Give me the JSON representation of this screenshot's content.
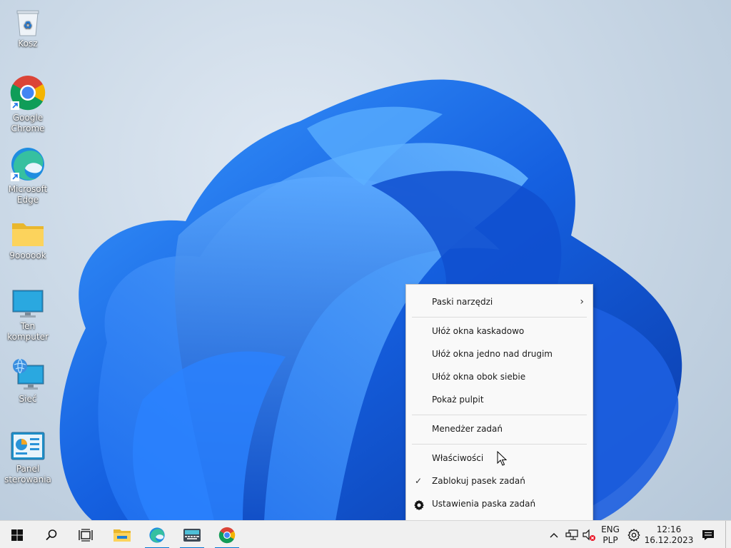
{
  "desktop": {
    "icons": [
      {
        "label": "Kosz",
        "icon": "recycle-bin-icon"
      },
      {
        "label": "Google Chrome",
        "icon": "chrome-icon"
      },
      {
        "label": "Microsoft Edge",
        "icon": "edge-icon"
      },
      {
        "label": "9oooook",
        "icon": "folder-icon"
      },
      {
        "label": "Ten komputer",
        "icon": "computer-icon"
      },
      {
        "label": "Sieć",
        "icon": "network-icon"
      },
      {
        "label": "Panel sterowania",
        "icon": "control-panel-icon"
      }
    ]
  },
  "context_menu": {
    "toolbars": "Paski narzędzi",
    "cascade": "Ułóż okna kaskadowo",
    "stacked": "Ułóż okna jedno nad drugim",
    "side_by_side": "Ułóż okna obok siebie",
    "show_desktop": "Pokaż pulpit",
    "task_manager": "Menedżer zadań",
    "properties": "Właściwości",
    "lock_taskbar": "Zablokuj pasek zadań",
    "lock_taskbar_checked": true,
    "taskbar_settings": "Ustawienia paska zadań"
  },
  "taskbar": {
    "apps": [
      "start-icon",
      "search-icon",
      "task-view-icon",
      "file-explorer-icon",
      "edge-icon",
      "on-screen-keyboard-icon",
      "chrome-icon"
    ],
    "tray": {
      "lang_top": "ENG",
      "lang_bottom": "PLP",
      "time": "12:16",
      "date": "16.12.2023"
    }
  },
  "colors": {
    "accent": "#0078d4",
    "wallpaper_blue": "#1a6fe8",
    "menu_bg": "#f9f9f9",
    "taskbar_bg": "#f0f0f0"
  }
}
